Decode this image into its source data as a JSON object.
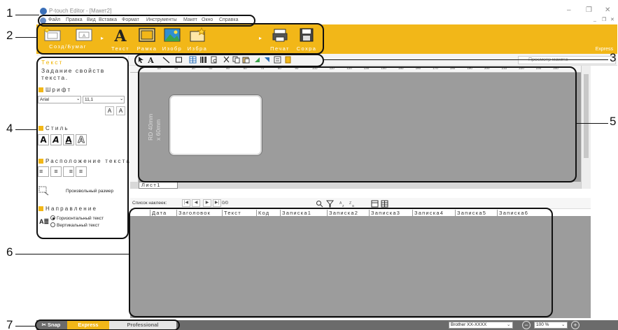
{
  "callouts": [
    "1",
    "2",
    "3",
    "4",
    "5",
    "6",
    "7"
  ],
  "window": {
    "title": "P-touch Editor - [Макет2]",
    "controls": [
      "–",
      "❐",
      "✕"
    ],
    "mdi_controls": [
      "_",
      "❐",
      "✕"
    ]
  },
  "menu": [
    "Файл",
    "Правка",
    "Вид",
    "Вставка",
    "Формат",
    "Инструменты",
    "Макет",
    "Окно",
    "Справка"
  ],
  "ribbon": {
    "buttons": [
      {
        "label": "Созд/Бумаг",
        "icon": "new-paper-icon"
      },
      {
        "label": "Текст",
        "icon": "text-A-icon"
      },
      {
        "label": "Рамка",
        "icon": "frame-icon"
      },
      {
        "label": "Изобр",
        "icon": "image-icon"
      },
      {
        "label": "Избра",
        "icon": "favorites-icon"
      },
      {
        "label": "Печат",
        "icon": "printer-icon"
      },
      {
        "label": "Сохра",
        "icon": "save-icon"
      }
    ],
    "mode_label": "Express"
  },
  "draw_toolbar": {
    "tools": [
      "select-arrow-icon",
      "text-tool-icon",
      "line-tool-icon",
      "shape-tool-icon",
      "table-tool-icon",
      "barcode-tool-icon",
      "print-preview-icon",
      "cut-icon",
      "copy-icon",
      "paste-icon",
      "move-front-icon",
      "move-back-icon",
      "object-list-icon",
      "database-icon"
    ],
    "search_placeholder": "Просмотр макета"
  },
  "property_panel": {
    "title": "Текст",
    "description": "Задание свойств текста.",
    "font_section": "Шрифт",
    "font_name": "Arial",
    "font_size": "11,1",
    "grow_font": "A",
    "shrink_font": "A",
    "style_section": "Стиль",
    "style_buttons": [
      "A",
      "A",
      "A",
      "A"
    ],
    "alignment_section": "Расположение текста",
    "alignment_buttons": [
      "≡",
      "≡",
      "≡",
      "≡"
    ],
    "free_size_label": "Произвольный размер",
    "direction_section": "Направление",
    "direction_options": [
      {
        "label": "Горизонтальный текст",
        "selected": true
      },
      {
        "label": "Вертикальный текст",
        "selected": false
      }
    ]
  },
  "canvas": {
    "ruler_marks": [
      "0",
      "10",
      "20",
      "30",
      "40",
      "50",
      "60",
      "70",
      "80",
      "90",
      "100",
      "110",
      "120",
      "130",
      "140",
      "150",
      "160",
      "170",
      "180",
      "190",
      "200",
      "210",
      "220",
      "230",
      "240"
    ],
    "media_label_line1": "RD 40mm",
    "media_label_line2": "x 60mm",
    "sheet_tab": "Лист1"
  },
  "database": {
    "list_label": "Список наклеек:",
    "nav_buttons": [
      "|◀",
      "◀",
      "▶",
      "▶|"
    ],
    "record_count": "0/0",
    "columns": [
      "Дата",
      "Заголовок",
      "Текст",
      "Код",
      "Записка1",
      "Записка2",
      "Записка3",
      "Записка4",
      "Записка5",
      "Записка6"
    ]
  },
  "statusbar": {
    "modes": [
      "Snap",
      "Express",
      "Professional"
    ],
    "active_mode": "Express",
    "printer": "Brother XX-XXXX",
    "zoom": "100 %",
    "zoom_out": "−",
    "zoom_in": "+"
  },
  "colors": {
    "accent": "#f2b718",
    "canvas_bg": "#9c9c9c",
    "statusbar": "#6b6b6b"
  }
}
